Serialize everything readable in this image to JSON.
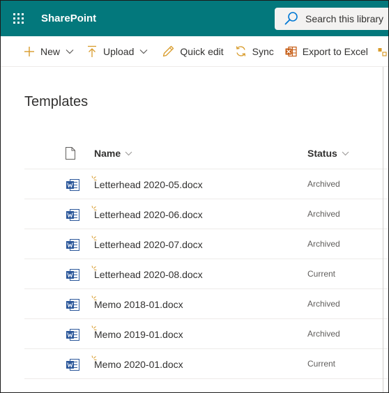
{
  "suite": {
    "brand": "SharePoint",
    "search_placeholder": "Search this library",
    "bar_color": "#03787c"
  },
  "commands": [
    {
      "id": "new",
      "label": "New",
      "icon": "plus-icon",
      "dropdown": true
    },
    {
      "id": "upload",
      "label": "Upload",
      "icon": "upload-arrow-icon",
      "dropdown": true
    },
    {
      "id": "quick-edit",
      "label": "Quick edit",
      "icon": "pencil-icon",
      "dropdown": false
    },
    {
      "id": "sync",
      "label": "Sync",
      "icon": "sync-icon",
      "dropdown": false
    },
    {
      "id": "export",
      "label": "Export to Excel",
      "icon": "excel-icon",
      "dropdown": false
    }
  ],
  "library": {
    "title": "Templates",
    "columns": {
      "name": "Name",
      "status": "Status"
    },
    "files": [
      {
        "name": "Letterhead 2020-05.docx",
        "status": "Archived"
      },
      {
        "name": "Letterhead 2020-06.docx",
        "status": "Archived"
      },
      {
        "name": "Letterhead 2020-07.docx",
        "status": "Archived"
      },
      {
        "name": "Letterhead 2020-08.docx",
        "status": "Current"
      },
      {
        "name": "Memo 2018-01.docx",
        "status": "Archived"
      },
      {
        "name": "Memo 2019-01.docx",
        "status": "Archived"
      },
      {
        "name": "Memo 2020-01.docx",
        "status": "Current"
      }
    ]
  },
  "colors": {
    "accent": "#d89b2b",
    "word_blue": "#2b579a",
    "excel_orange": "#c55a11"
  }
}
